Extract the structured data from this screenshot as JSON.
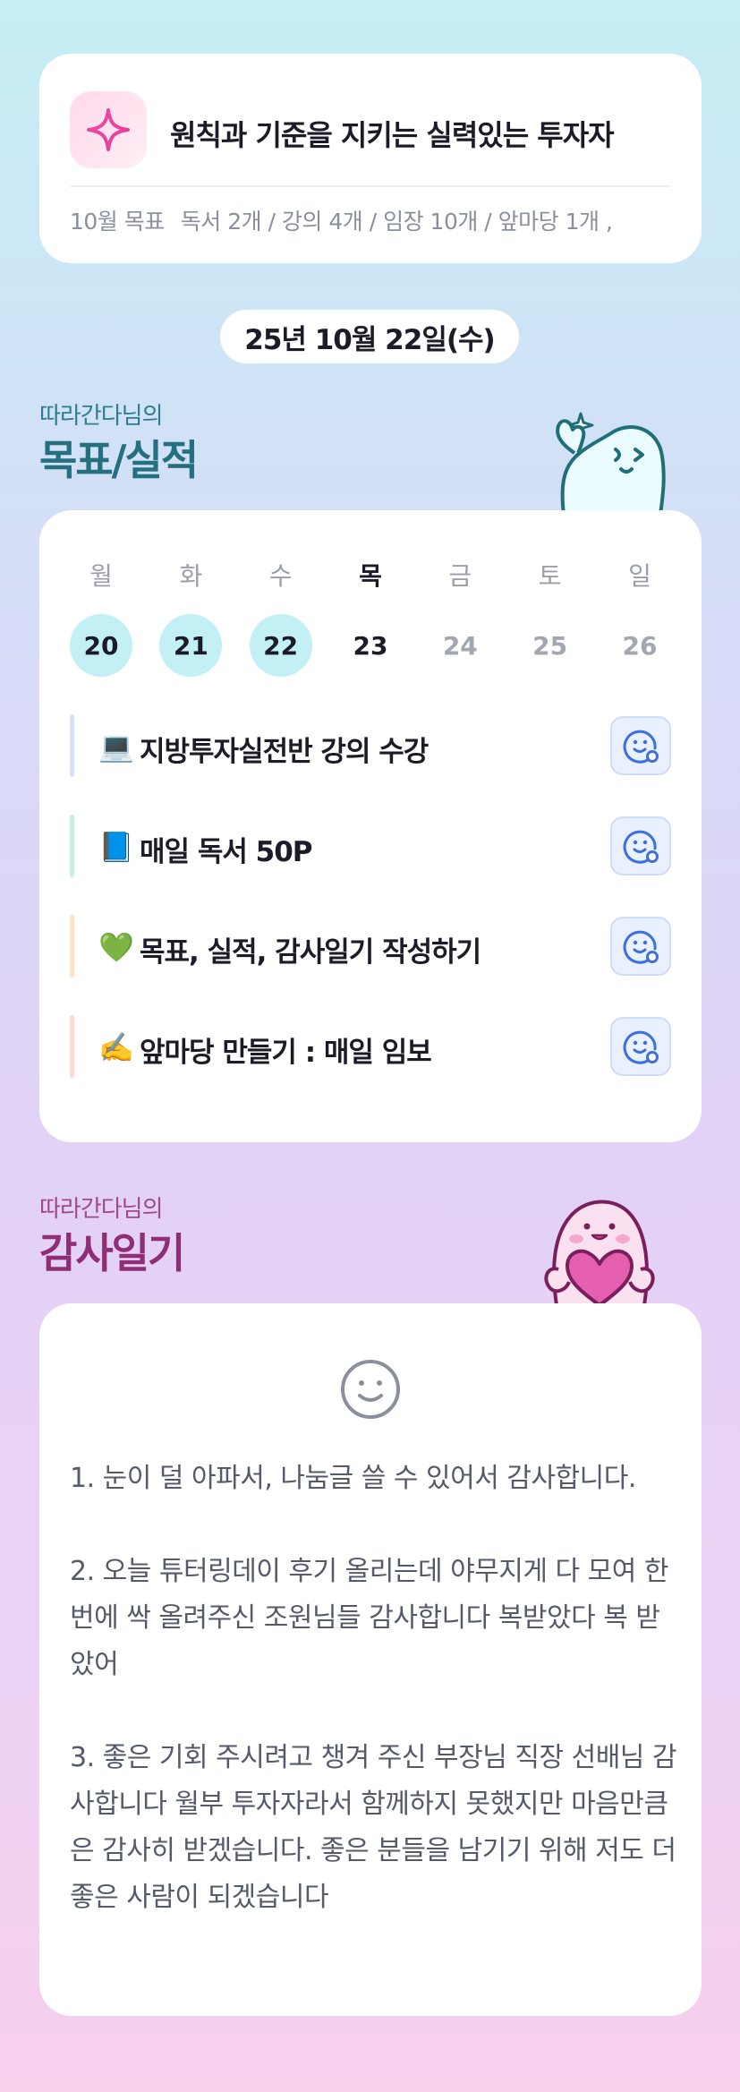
{
  "goal_card": {
    "headline": "원칙과 기준을 지키는 실력있는 투자자",
    "goal_label": "10월 목표",
    "goal_text": "독서 2개 / 강의 4개 / 임장 10개 / 앞마당 1개 ,",
    "icon": "sparkle-icon"
  },
  "date": "25년 10월 22일(수)",
  "performance": {
    "subtitle": "따라간다님의",
    "title": "목표/실적",
    "weekdays": [
      "월",
      "화",
      "수",
      "목",
      "금",
      "토",
      "일"
    ],
    "days": [
      "20",
      "21",
      "22",
      "23",
      "24",
      "25",
      "26"
    ],
    "tasks": [
      {
        "emoji": "💻",
        "label": "지방투자실전반 강의 수강",
        "bar_color": "#d7e0fb"
      },
      {
        "emoji": "📘",
        "label": "매일 독서 50P",
        "bar_color": "#c7f0dd"
      },
      {
        "emoji": "💚",
        "label": "목표, 실적, 감사일기 작성하기",
        "bar_color": "#fde3c4"
      },
      {
        "emoji": "✍️",
        "label": "앞마당 만들기 : 매일 임보",
        "bar_color": "#fdd8d4"
      }
    ]
  },
  "diary": {
    "subtitle": "따라간다님의",
    "title": "감사일기",
    "entries": [
      "1. 눈이 덜 아파서, 나눔글 쓸 수 있어서  감사합니다.",
      "2. 오늘 튜터링데이 후기 올리는데 야무지게 다 모여 한번에 싹 올려주신 조원님들 감사합니다 복받았다 복 받았어",
      "3. 좋은 기회 주시려고 챙겨 주신 부장님 직장 선배님 감사합니다 월부 투자자라서 함께하지 못했지만 마음만큼은 감사히 받겠습니다. 좋은 분들을 남기기 위해 저도 더 좋은 사람이 되겠습니다"
    ]
  },
  "colors": {
    "accent_teal": "#24707f",
    "accent_magenta": "#8f2e74",
    "done_day_bg": "#c3f0f5",
    "feedback_button_bg": "#e9f0ff"
  }
}
